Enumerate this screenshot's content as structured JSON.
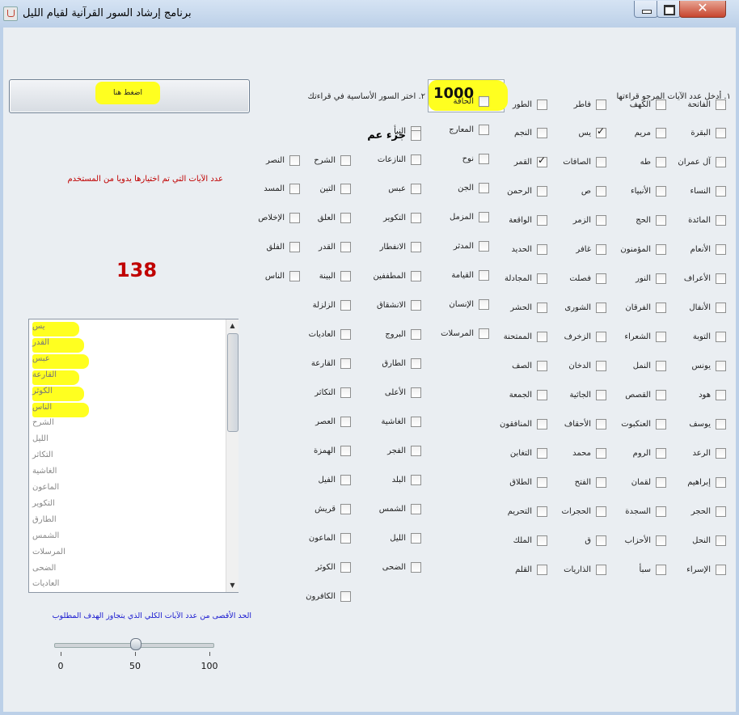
{
  "window": {
    "title": "برنامج إرشاد السور القرآنية لقيام الليل"
  },
  "step1_label": "١. أدخل عدد الآيات المرجو قراءتها",
  "step2_label": "٢. اختر السور الأساسية في قراءتك",
  "ayat_input": "1000",
  "press_button": "اضغط هنا",
  "manual_label": "عدد الآيات التي تم اختيارها يدويا من المستخدم",
  "manual_count": "138",
  "result_list": [
    {
      "label": "يس",
      "highlight": true
    },
    {
      "label": "القدر",
      "highlight": true
    },
    {
      "label": "عبس",
      "highlight": true
    },
    {
      "label": "القارعة",
      "highlight": true
    },
    {
      "label": "الكوثر",
      "highlight": true
    },
    {
      "label": "الناس",
      "highlight": true
    },
    {
      "label": "الشرح",
      "highlight": false
    },
    {
      "label": "الليل",
      "highlight": false
    },
    {
      "label": "التكاثر",
      "highlight": false
    },
    {
      "label": "الغاشية",
      "highlight": false
    },
    {
      "label": "الماعون",
      "highlight": false
    },
    {
      "label": "التكوير",
      "highlight": false
    },
    {
      "label": "الطارق",
      "highlight": false
    },
    {
      "label": "الشمس",
      "highlight": false
    },
    {
      "label": "المرسلات",
      "highlight": false
    },
    {
      "label": "الضحى",
      "highlight": false
    },
    {
      "label": "العاديات",
      "highlight": false
    }
  ],
  "slider": {
    "caption": "الحد الأقصى من عدد الآيات الكلي الذي يتجاوز الهدف المطلوب",
    "value": 50,
    "min": 0,
    "max": 100,
    "tick_labels": [
      "0",
      "50",
      "100"
    ]
  },
  "juz_amma_label": "جزء عم",
  "surah_columns": [
    [
      {
        "label": "الفاتحة",
        "checked": false
      },
      {
        "label": "البقرة",
        "checked": false
      },
      {
        "label": "آل عمران",
        "checked": false
      },
      {
        "label": "النساء",
        "checked": false
      },
      {
        "label": "المائدة",
        "checked": false
      },
      {
        "label": "الأنعام",
        "checked": false
      },
      {
        "label": "الأعراف",
        "checked": false
      },
      {
        "label": "الأنفال",
        "checked": false
      },
      {
        "label": "التوبة",
        "checked": false
      },
      {
        "label": "يونس",
        "checked": false
      },
      {
        "label": "هود",
        "checked": false
      },
      {
        "label": "يوسف",
        "checked": false
      },
      {
        "label": "الرعد",
        "checked": false
      },
      {
        "label": "إبراهيم",
        "checked": false
      },
      {
        "label": "الحجر",
        "checked": false
      },
      {
        "label": "النحل",
        "checked": false
      },
      {
        "label": "الإسراء",
        "checked": false
      }
    ],
    [
      {
        "label": "الكهف",
        "checked": false
      },
      {
        "label": "مريم",
        "checked": false
      },
      {
        "label": "طه",
        "checked": false
      },
      {
        "label": "الأنبياء",
        "checked": false
      },
      {
        "label": "الحج",
        "checked": false
      },
      {
        "label": "المؤمنون",
        "checked": false
      },
      {
        "label": "النور",
        "checked": false
      },
      {
        "label": "الفرقان",
        "checked": false
      },
      {
        "label": "الشعراء",
        "checked": false
      },
      {
        "label": "النمل",
        "checked": false
      },
      {
        "label": "القصص",
        "checked": false
      },
      {
        "label": "العنكبوت",
        "checked": false
      },
      {
        "label": "الروم",
        "checked": false
      },
      {
        "label": "لقمان",
        "checked": false
      },
      {
        "label": "السجدة",
        "checked": false
      },
      {
        "label": "الأحزاب",
        "checked": false
      },
      {
        "label": "سبأ",
        "checked": false
      }
    ],
    [
      {
        "label": "فاطر",
        "checked": false
      },
      {
        "label": "يس",
        "checked": true
      },
      {
        "label": "الصافات",
        "checked": false
      },
      {
        "label": "ص",
        "checked": false
      },
      {
        "label": "الزمر",
        "checked": false
      },
      {
        "label": "غافر",
        "checked": false
      },
      {
        "label": "فصلت",
        "checked": false
      },
      {
        "label": "الشورى",
        "checked": false
      },
      {
        "label": "الزخرف",
        "checked": false
      },
      {
        "label": "الدخان",
        "checked": false
      },
      {
        "label": "الجاثية",
        "checked": false
      },
      {
        "label": "الأحقاف",
        "checked": false
      },
      {
        "label": "محمد",
        "checked": false
      },
      {
        "label": "الفتح",
        "checked": false
      },
      {
        "label": "الحجرات",
        "checked": false
      },
      {
        "label": "ق",
        "checked": false
      },
      {
        "label": "الذاريات",
        "checked": false
      }
    ],
    [
      {
        "label": "الطور",
        "checked": false
      },
      {
        "label": "النجم",
        "checked": false
      },
      {
        "label": "القمر",
        "checked": true
      },
      {
        "label": "الرحمن",
        "checked": false
      },
      {
        "label": "الواقعة",
        "checked": false
      },
      {
        "label": "الحديد",
        "checked": false
      },
      {
        "label": "المجادلة",
        "checked": false
      },
      {
        "label": "الحشر",
        "checked": false
      },
      {
        "label": "الممتحنة",
        "checked": false
      },
      {
        "label": "الصف",
        "checked": false
      },
      {
        "label": "الجمعة",
        "checked": false
      },
      {
        "label": "المنافقون",
        "checked": false
      },
      {
        "label": "التغابن",
        "checked": false
      },
      {
        "label": "الطلاق",
        "checked": false
      },
      {
        "label": "التحريم",
        "checked": false
      },
      {
        "label": "الملك",
        "checked": false
      },
      {
        "label": "القلم",
        "checked": false
      }
    ],
    [
      {
        "label": "الحاقة",
        "checked": false
      },
      {
        "label": "المعارج",
        "checked": false
      },
      {
        "label": "نوح",
        "checked": false
      },
      {
        "label": "الجن",
        "checked": false
      },
      {
        "label": "المزمل",
        "checked": false
      },
      {
        "label": "المدثر",
        "checked": false
      },
      {
        "label": "القيامة",
        "checked": false
      },
      {
        "label": "الإنسان",
        "checked": false
      },
      {
        "label": "المرسلات",
        "checked": false
      }
    ],
    [
      {
        "label": "النبأ",
        "checked": false
      },
      {
        "label": "النازعات",
        "checked": false
      },
      {
        "label": "عبس",
        "checked": false
      },
      {
        "label": "التكوير",
        "checked": false
      },
      {
        "label": "الانفطار",
        "checked": false
      },
      {
        "label": "المطففين",
        "checked": false
      },
      {
        "label": "الانشقاق",
        "checked": false
      },
      {
        "label": "البروج",
        "checked": false
      },
      {
        "label": "الطارق",
        "checked": false
      },
      {
        "label": "الأعلى",
        "checked": false
      },
      {
        "label": "الغاشية",
        "checked": false
      },
      {
        "label": "الفجر",
        "checked": false
      },
      {
        "label": "البلد",
        "checked": false
      },
      {
        "label": "الشمس",
        "checked": false
      },
      {
        "label": "الليل",
        "checked": false
      },
      {
        "label": "الضحى",
        "checked": false
      }
    ],
    [
      {
        "label": "الشرح",
        "checked": false
      },
      {
        "label": "التين",
        "checked": false
      },
      {
        "label": "العلق",
        "checked": false
      },
      {
        "label": "القدر",
        "checked": false
      },
      {
        "label": "البينة",
        "checked": false
      },
      {
        "label": "الزلزلة",
        "checked": false
      },
      {
        "label": "العاديات",
        "checked": false
      },
      {
        "label": "القارعة",
        "checked": false
      },
      {
        "label": "التكاثر",
        "checked": false
      },
      {
        "label": "العصر",
        "checked": false
      },
      {
        "label": "الهمزة",
        "checked": false
      },
      {
        "label": "الفيل",
        "checked": false
      },
      {
        "label": "قريش",
        "checked": false
      },
      {
        "label": "الماعون",
        "checked": false
      },
      {
        "label": "الكوثر",
        "checked": false
      },
      {
        "label": "الكافرون",
        "checked": false
      }
    ],
    [
      {
        "label": "النصر",
        "checked": false
      },
      {
        "label": "المسد",
        "checked": false
      },
      {
        "label": "الإخلاص",
        "checked": false
      },
      {
        "label": "الفلق",
        "checked": false
      },
      {
        "label": "الناس",
        "checked": false
      }
    ]
  ]
}
